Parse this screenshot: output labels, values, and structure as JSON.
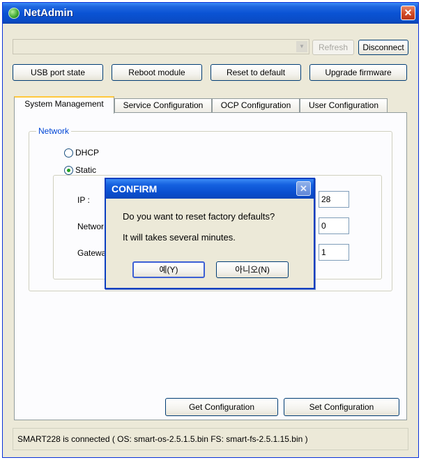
{
  "window": {
    "title": "NetAdmin",
    "close_glyph": "✕",
    "app_icon": "netadmin-globe-icon"
  },
  "connection": {
    "combo_value": "",
    "combo_arrow": "▼",
    "refresh_label": "Refresh",
    "disconnect_label": "Disconnect"
  },
  "actions": {
    "usb_port_state": "USB port state",
    "reboot_module": "Reboot module",
    "reset_to_default": "Reset to default",
    "upgrade_firmware": "Upgrade firmware"
  },
  "tabs": [
    {
      "label": "System Management",
      "active": true
    },
    {
      "label": "Service Configuration",
      "active": false
    },
    {
      "label": "OCP Configuration",
      "active": false
    },
    {
      "label": "User Configuration",
      "active": false
    }
  ],
  "network": {
    "legend": "Network",
    "dhcp_label": "DHCP",
    "static_label": "Static",
    "selected": "Static",
    "ip_label": "IP :",
    "netmask_label": "Networ",
    "gateway_label": "Gatewa",
    "ip_value": "28",
    "netmask_value": "0",
    "gateway_value": "1"
  },
  "footer_buttons": {
    "get_configuration": "Get Configuration",
    "set_configuration": "Set Configuration"
  },
  "status": {
    "text": "SMART228 is connected ( OS: smart-os-2.5.1.5.bin  FS: smart-fs-2.5.1.15.bin )"
  },
  "confirm_dialog": {
    "title": "CONFIRM",
    "close_glyph": "✕",
    "message_line1": "Do you want to reset factory defaults?",
    "message_line2": "It will takes several minutes.",
    "yes_label": "예(Y)",
    "no_label": "아니오(N)"
  },
  "colors": {
    "titlebar": "#0a53d4",
    "window_bg": "#ece9d8",
    "group_legend": "#0046d5",
    "active_tab_accent": "#ffc83c",
    "close_button": "#d24a24"
  }
}
